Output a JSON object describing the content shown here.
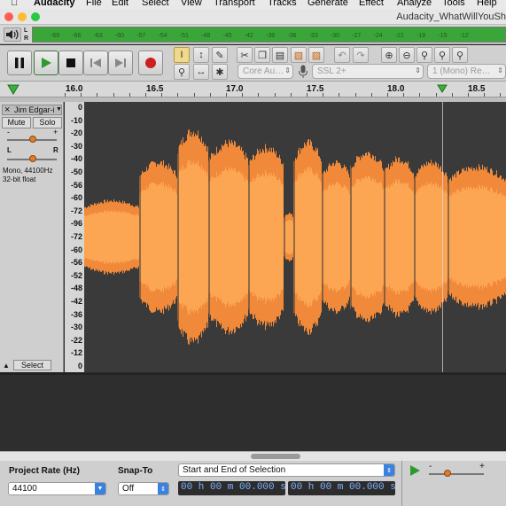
{
  "menubar": {
    "apple_icon": "apple-icon",
    "app_name": "Audacity",
    "items": [
      "File",
      "Edit",
      "Select",
      "View",
      "Transport",
      "Tracks",
      "Generate",
      "Effect",
      "Analyze",
      "Tools",
      "Help"
    ]
  },
  "window": {
    "title": "Audacity_WhatWillYouSh"
  },
  "meter": {
    "channels": [
      "L",
      "R"
    ],
    "ticks": [
      "-69",
      "-66",
      "-63",
      "-60",
      "-57",
      "-54",
      "-51",
      "-48",
      "-45",
      "-42",
      "-39",
      "-36",
      "-33",
      "-30",
      "-27",
      "-24",
      "-21",
      "-18",
      "-15",
      "-12"
    ],
    "color": "#3aa63a"
  },
  "transport": {
    "buttons": [
      "pause",
      "play",
      "stop",
      "skip-start",
      "skip-end",
      "record"
    ],
    "play_color": "#2e9a2e",
    "record_color": "#cc1f1f"
  },
  "devices": {
    "host": "Core Au…",
    "output": "SSL 2+",
    "channels": "1 (Mono) Re…"
  },
  "ruler": {
    "labels": [
      "16.0",
      "16.5",
      "17.0",
      "17.5",
      "18.0",
      "18.5"
    ]
  },
  "track": {
    "name": "Jim Edgar-ipD",
    "mute_label": "Mute",
    "solo_label": "Solo",
    "gain_minus": "-",
    "gain_plus": "+",
    "pan_left": "L",
    "pan_right": "R",
    "info_line1": "Mono, 44100Hz",
    "info_line2": "32-bit float",
    "select_label": "Select",
    "collapse_icon": "triangle-up-icon",
    "close_icon": "close-icon"
  },
  "yaxis": {
    "labels": [
      "0",
      "-10",
      "-20",
      "-30",
      "-40",
      "-50",
      "-56",
      "-60",
      "-72",
      "-96",
      "-72",
      "-60",
      "-56",
      "-52",
      "-48",
      "-42",
      "-36",
      "-30",
      "-22",
      "-12",
      "0"
    ]
  },
  "waveform": {
    "color": "#fca552",
    "peak_color": "#f1893a",
    "background": "#3a3a3a"
  },
  "selection_toolbar": {
    "project_rate_label": "Project Rate (Hz)",
    "project_rate_value": "44100",
    "snap_label": "Snap-To",
    "snap_value": "Off",
    "selection_mode": "Start and End of Selection",
    "start_time": "00 h 00 m 00.000 s",
    "end_time": "00 h 00 m 00.000 s",
    "speed_minus": "-",
    "speed_plus": "+"
  }
}
